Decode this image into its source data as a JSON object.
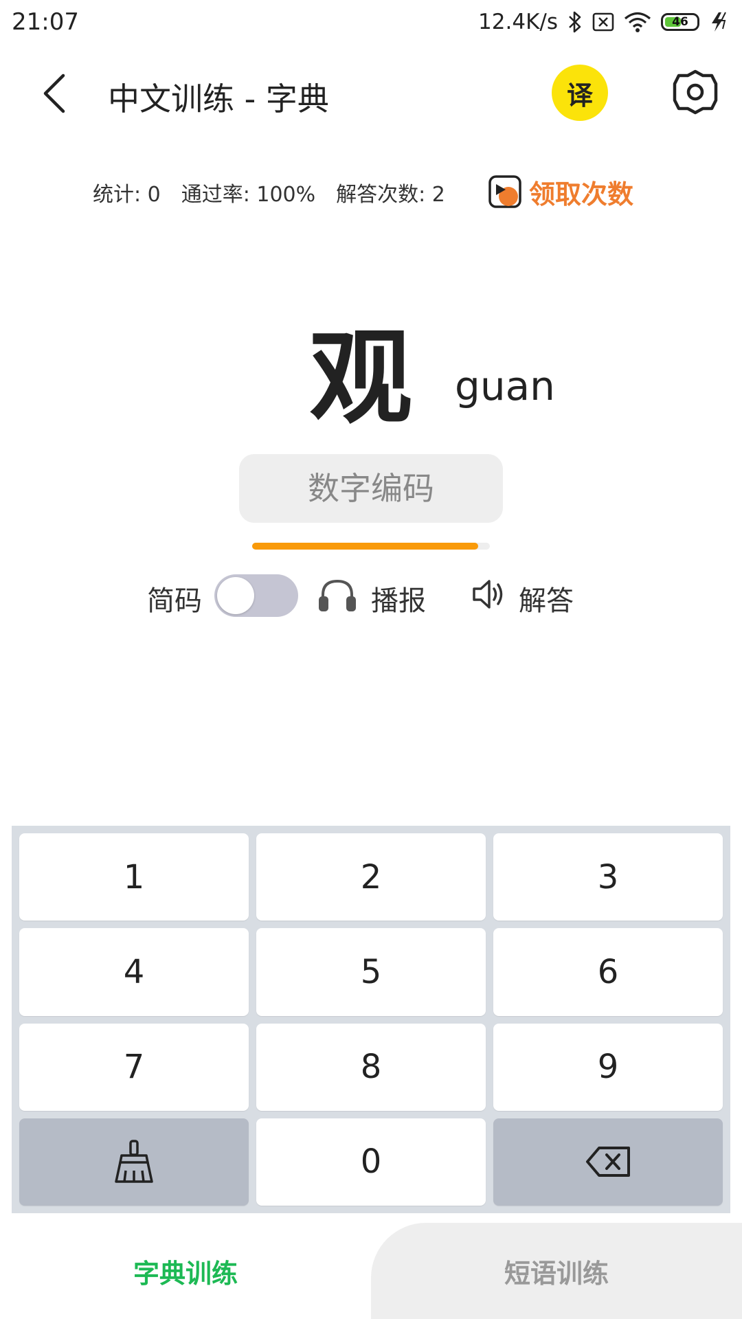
{
  "status_bar": {
    "time": "21:07",
    "net_speed": "12.4K/s",
    "battery": "46",
    "icons": [
      "bluetooth-icon",
      "sim-off-icon",
      "wifi-icon",
      "battery-icon",
      "charging-icon"
    ]
  },
  "header": {
    "title": "中文训练 - 字典",
    "translate_label": "译",
    "translate_color": "#fbe30a"
  },
  "stats": {
    "count": "统计: 0",
    "pass_rate": "通过率: 100%",
    "answer_times": "解答次数: 2",
    "claim_label": "领取次数",
    "claim_color": "#ef7d2e"
  },
  "main": {
    "character": "观",
    "pinyin": "guan",
    "code_input_placeholder": "数字编码",
    "code_input_value": "",
    "progress": 0.95,
    "progress_color": "#f99a0a"
  },
  "options": {
    "short_code_label": "简码",
    "short_code_on": false,
    "broadcast_label": "播报",
    "answer_label": "解答"
  },
  "keypad": {
    "keys": [
      "1",
      "2",
      "3",
      "4",
      "5",
      "6",
      "7",
      "8",
      "9",
      "0"
    ],
    "clear_icon": "broom-icon",
    "backspace_icon": "backspace-icon"
  },
  "tabs": {
    "active": "字典训练",
    "inactive": "短语训练",
    "active_color": "#1db954"
  }
}
